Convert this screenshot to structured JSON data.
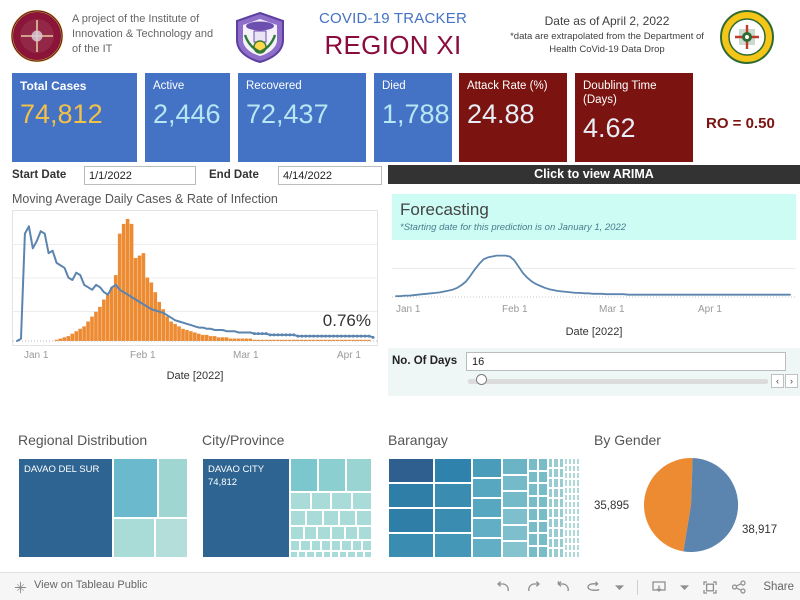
{
  "header": {
    "project_line": "A project of the Institute of Innovation & Technology and of the IT",
    "tracker_label": "COVID-19 TRACKER",
    "region_title": "REGION XI",
    "date_as_of": "Date as of April 2, 2022",
    "disclaimer": "*data are extrapolated from the Department of Health CoVid-19 Data Drop",
    "logo_left_name": "institute-seal",
    "logo_mid_name": "college-seal",
    "logo_right_name": "department-of-health-seal"
  },
  "kpis": [
    {
      "label": "Total Cases",
      "value": "74,812",
      "theme": "blue",
      "value_color": "#f2c14a"
    },
    {
      "label": "Active",
      "value": "2,446",
      "theme": "blue",
      "value_color": "#b7e6f5"
    },
    {
      "label": "Recovered",
      "value": "72,437",
      "theme": "blue",
      "value_color": "#b7e6f5"
    },
    {
      "label": "Died",
      "value": "1,788",
      "theme": "blue",
      "value_color": "#b7e6f5"
    },
    {
      "label": "Attack Rate (%)",
      "value": "24.88",
      "theme": "dark",
      "value_color": "#e8eef8"
    },
    {
      "label": "Doubling Time (Days)",
      "value": "4.62",
      "theme": "dark",
      "value_color": "#e8eef8"
    }
  ],
  "ro_badge": "RO = 0.50",
  "filters": {
    "start_date_label": "Start Date",
    "start_date_value": "1/1/2022",
    "end_date_label": "End Date",
    "end_date_value": "4/14/2022"
  },
  "arima": {
    "banner": "Click to view ARIMA"
  },
  "forecast": {
    "title": "Forecasting",
    "subtitle": "*Starting date for this prediction is on January 1, 2022",
    "days_label": "No. Of Days",
    "days_value": "16",
    "prev_label": "‹",
    "next_label": "›"
  },
  "left_chart": {
    "title": "Moving Average Daily Cases & Rate of Infection",
    "rate_annotation": "0.76%"
  },
  "bottom": {
    "regional": {
      "title": "Regional Distribution",
      "top_label": "DAVAO DEL SUR"
    },
    "city": {
      "title": "City/Province",
      "top_label": "DAVAO CITY",
      "top_value": "74,812"
    },
    "barangay": {
      "title": "Barangay"
    },
    "gender": {
      "title": "By Gender",
      "left_value": "35,895",
      "right_value": "38,917",
      "left_color": "#ed8b33",
      "right_color": "#5b84ae"
    }
  },
  "toolbar": {
    "view_label": "View on Tableau Public",
    "share_label": "Share",
    "icons": [
      "undo-icon",
      "redo-icon",
      "revert-icon",
      "refresh-icon",
      "pause-dropdown-icon",
      "download-icon",
      "fullscreen-icon",
      "share-icon"
    ]
  },
  "chart_data": [
    {
      "type": "line",
      "name": "moving-average-daily-cases-and-rate-of-infection",
      "title": "Moving Average Daily Cases & Rate of Infection",
      "xlabel": "Date [2022]",
      "ylabel": "",
      "tick_labels": [
        "Jan 1",
        "Feb 1",
        "Mar 1",
        "Apr 1"
      ],
      "grid": true,
      "annotation": "0.76%",
      "series": [
        {
          "name": "Rate of Infection",
          "type": "line",
          "color": "#5b84ae",
          "values": [
            0,
            2,
            88,
            94,
            76,
            82,
            90,
            88,
            72,
            74,
            64,
            62,
            60,
            52,
            50,
            56,
            54,
            46,
            44,
            42,
            46,
            44,
            40,
            38,
            44,
            46,
            42,
            40,
            38,
            36,
            34,
            32,
            30,
            28,
            26,
            25,
            24,
            23,
            21,
            19,
            17,
            16,
            15,
            14,
            13,
            12,
            11,
            11,
            10,
            10,
            9,
            9,
            9,
            8,
            8,
            8,
            7,
            7,
            7,
            7,
            6,
            6,
            6,
            6,
            5,
            5,
            5,
            5,
            5,
            5,
            5,
            4,
            4,
            4,
            4,
            4,
            4,
            4,
            4,
            4,
            4,
            4,
            4,
            4,
            4,
            4,
            4,
            4,
            4,
            4,
            3
          ]
        },
        {
          "name": "Moving Average Daily Cases",
          "type": "bar",
          "color": "#ed8b33",
          "values": [
            0,
            0,
            0,
            0,
            0,
            0,
            0,
            0,
            0,
            0,
            1,
            2,
            3,
            4,
            6,
            8,
            10,
            12,
            16,
            20,
            24,
            28,
            34,
            38,
            44,
            54,
            88,
            96,
            100,
            96,
            68,
            70,
            72,
            52,
            48,
            40,
            32,
            26,
            20,
            16,
            14,
            12,
            10,
            9,
            8,
            7,
            6,
            5,
            5,
            4,
            4,
            3,
            3,
            3,
            2,
            2,
            2,
            2,
            2,
            2,
            1,
            1,
            1,
            1,
            1,
            1,
            1,
            1,
            1,
            1,
            1,
            1,
            1,
            1,
            1,
            1,
            1,
            1,
            1,
            1,
            1,
            1,
            1,
            1,
            1,
            1,
            1,
            1,
            1,
            1,
            0
          ]
        }
      ]
    },
    {
      "type": "line",
      "name": "arima-forecast",
      "title": "Forecasting",
      "subtitle": "*Starting date for this prediction is on January 1, 2022",
      "xlabel": "Date [2022]",
      "tick_labels": [
        "Jan 1",
        "Feb 1",
        "Mar 1",
        "Apr 1"
      ],
      "grid": true,
      "series": [
        {
          "name": "Forecast",
          "color": "#5b84ae",
          "values": [
            2,
            2,
            3,
            3,
            4,
            5,
            6,
            7,
            8,
            9,
            10,
            12,
            14,
            16,
            20,
            26,
            34,
            46,
            60,
            72,
            82,
            86,
            88,
            90,
            90,
            90,
            88,
            80,
            66,
            52,
            42,
            34,
            28,
            24,
            20,
            17,
            15,
            13,
            12,
            11,
            10,
            9,
            9,
            8,
            8,
            7,
            7,
            7,
            6,
            6,
            6,
            6,
            6,
            5,
            5,
            5,
            5,
            5,
            5,
            5,
            5,
            5,
            5,
            5,
            5,
            5,
            5,
            5,
            5,
            5,
            5,
            5,
            5,
            5,
            5,
            5,
            5,
            5,
            5,
            5,
            5,
            5,
            5,
            5,
            5,
            5,
            5,
            5,
            5,
            5,
            5
          ]
        }
      ]
    },
    {
      "type": "treemap",
      "name": "regional-distribution",
      "title": "Regional Distribution",
      "items": [
        {
          "label": "DAVAO DEL SUR",
          "value": 74812,
          "color": "#2e6491"
        },
        {
          "label": "",
          "value": 19000,
          "color": "#6ab9cc"
        },
        {
          "label": "",
          "value": 9000,
          "color": "#9fd6d2"
        },
        {
          "label": "",
          "value": 7000,
          "color": "#a9dcd6"
        },
        {
          "label": "",
          "value": 4000,
          "color": "#b3ded9"
        }
      ]
    },
    {
      "type": "treemap",
      "name": "city-province-distribution",
      "title": "City/Province",
      "items": [
        {
          "label": "DAVAO CITY",
          "value": 74812,
          "color": "#2e6491"
        },
        {
          "label": "",
          "value": 9000,
          "color": "#7cc7cd"
        },
        {
          "label": "",
          "value": 7000,
          "color": "#8dcfd1"
        },
        {
          "label": "",
          "value": 5000,
          "color": "#9bd5d3"
        },
        {
          "label": "",
          "value": 3000,
          "color": "#a9dcd8"
        }
      ]
    },
    {
      "type": "treemap",
      "name": "barangay-distribution",
      "title": "Barangay",
      "items": [
        {
          "label": "",
          "value": 100,
          "color": "#2e5f8f"
        },
        {
          "label": "",
          "value": 80,
          "color": "#2f82ab"
        },
        {
          "label": "",
          "value": 70,
          "color": "#3d93b5"
        },
        {
          "label": "",
          "value": 55,
          "color": "#5aa9bf"
        },
        {
          "label": "",
          "value": 40,
          "color": "#78bcc7"
        },
        {
          "label": "",
          "value": 25,
          "color": "#97cdd0"
        },
        {
          "label": "",
          "value": 12,
          "color": "#b0dad8"
        }
      ]
    },
    {
      "type": "pie",
      "name": "cases-by-gender",
      "title": "By Gender",
      "labels": [
        "35,895",
        "38,917"
      ],
      "values": [
        35895,
        38917
      ],
      "colors": [
        "#ed8b33",
        "#5b84ae"
      ]
    }
  ]
}
